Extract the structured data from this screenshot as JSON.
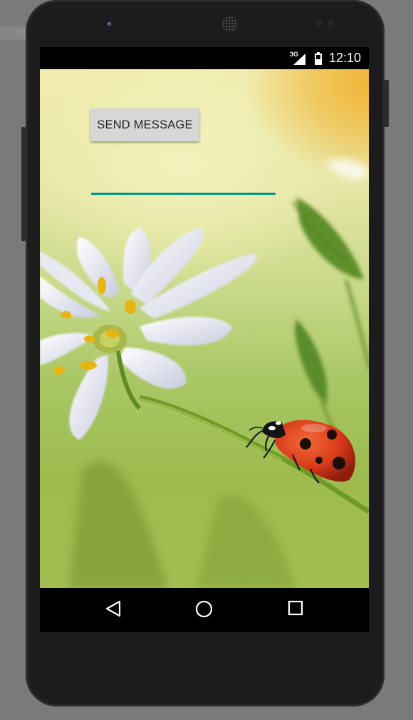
{
  "keyboard_hint": "Ctrl+N",
  "status_bar": {
    "network_type": "3G",
    "time": "12:10",
    "icons": [
      "signal-icon",
      "battery-icon"
    ]
  },
  "app": {
    "send_button_label": "SEND MESSAGE",
    "message_input_value": "",
    "accent_color": "#009688"
  },
  "nav_bar": {
    "icons": [
      "back-icon",
      "home-icon",
      "recents-icon"
    ]
  }
}
